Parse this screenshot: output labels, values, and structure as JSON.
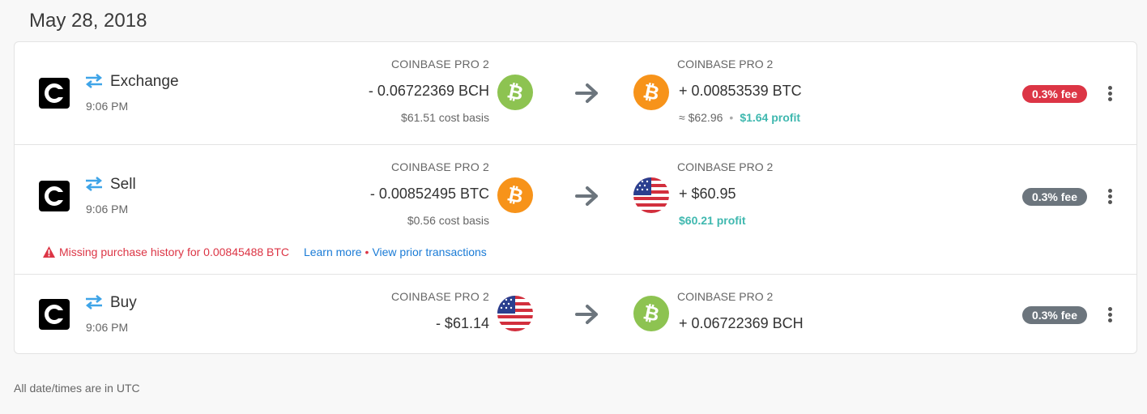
{
  "date_heading": "May 28, 2018",
  "footer_note": "All date/times are in UTC",
  "colors": {
    "bch": "#8dc351",
    "btc": "#f7931a",
    "profit": "#3fb8af",
    "fee_red": "#dc3545",
    "fee_gray": "#6c757d",
    "link": "#1a7bd6",
    "swap_icon": "#3ea4e8"
  },
  "transactions": [
    {
      "type": "Exchange",
      "time": "9:06 PM",
      "icon": "swap-arrows-icon",
      "source": {
        "label": "COINBASE PRO 2",
        "amount": "- 0.06722369 BCH",
        "basis": "$61.51 cost basis",
        "coin": "bch-icon"
      },
      "destination": {
        "label": "COINBASE PRO 2",
        "amount": "+ 0.00853539 BTC",
        "value": "≈ $62.96",
        "separator": "•",
        "profit": "$1.64 profit",
        "coin": "btc-icon"
      },
      "fee": "0.3% fee",
      "fee_color": "red"
    },
    {
      "type": "Sell",
      "time": "9:06 PM",
      "icon": "swap-arrows-icon",
      "source": {
        "label": "COINBASE PRO 2",
        "amount": "- 0.00852495 BTC",
        "basis": "$0.56 cost basis",
        "coin": "btc-icon"
      },
      "destination": {
        "label": "COINBASE PRO 2",
        "amount": "+ $60.95",
        "profit": "$60.21 profit",
        "coin": "usd-flag-icon"
      },
      "fee": "0.3% fee",
      "fee_color": "gray",
      "warning": {
        "text": "Missing purchase history for 0.00845488 BTC",
        "learn_more": "Learn more",
        "separator": "•",
        "view_prior": "View prior transactions"
      }
    },
    {
      "type": "Buy",
      "time": "9:06 PM",
      "icon": "swap-arrows-icon",
      "source": {
        "label": "COINBASE PRO 2",
        "amount": "- $61.14",
        "coin": "usd-flag-icon"
      },
      "destination": {
        "label": "COINBASE PRO 2",
        "amount": "+ 0.06722369 BCH",
        "coin": "bch-icon"
      },
      "fee": "0.3% fee",
      "fee_color": "gray"
    }
  ]
}
